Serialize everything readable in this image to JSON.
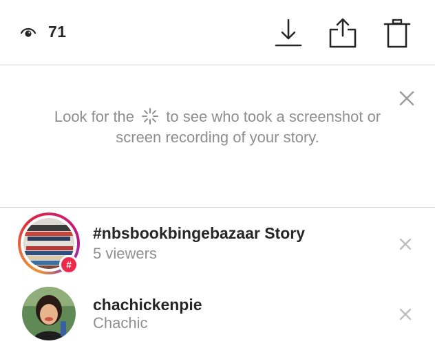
{
  "header": {
    "view_icon": "eye-icon",
    "view_count": "71",
    "actions": [
      "download-icon",
      "share-icon",
      "trash-icon"
    ]
  },
  "notice": {
    "text_before": "Look for the",
    "icon": "screenshot-sparkle-icon",
    "text_after": "to see who took a screenshot or screen recording of your story.",
    "dismiss_icon": "close-icon"
  },
  "viewers": [
    {
      "title": "#nbsbookbingebazaar Story",
      "subtitle": "5 viewers",
      "avatar": "hashtag-story-avatar",
      "badge": "#",
      "badge_color": "#ed2a4b"
    },
    {
      "title": "chachickenpie",
      "subtitle": "Chachic",
      "avatar": "user-avatar"
    }
  ],
  "colors": {
    "primary_text": "#262626",
    "secondary_text": "#8e8e8e",
    "divider": "#dbdbdb",
    "close_icon": "#bdbdbd"
  }
}
